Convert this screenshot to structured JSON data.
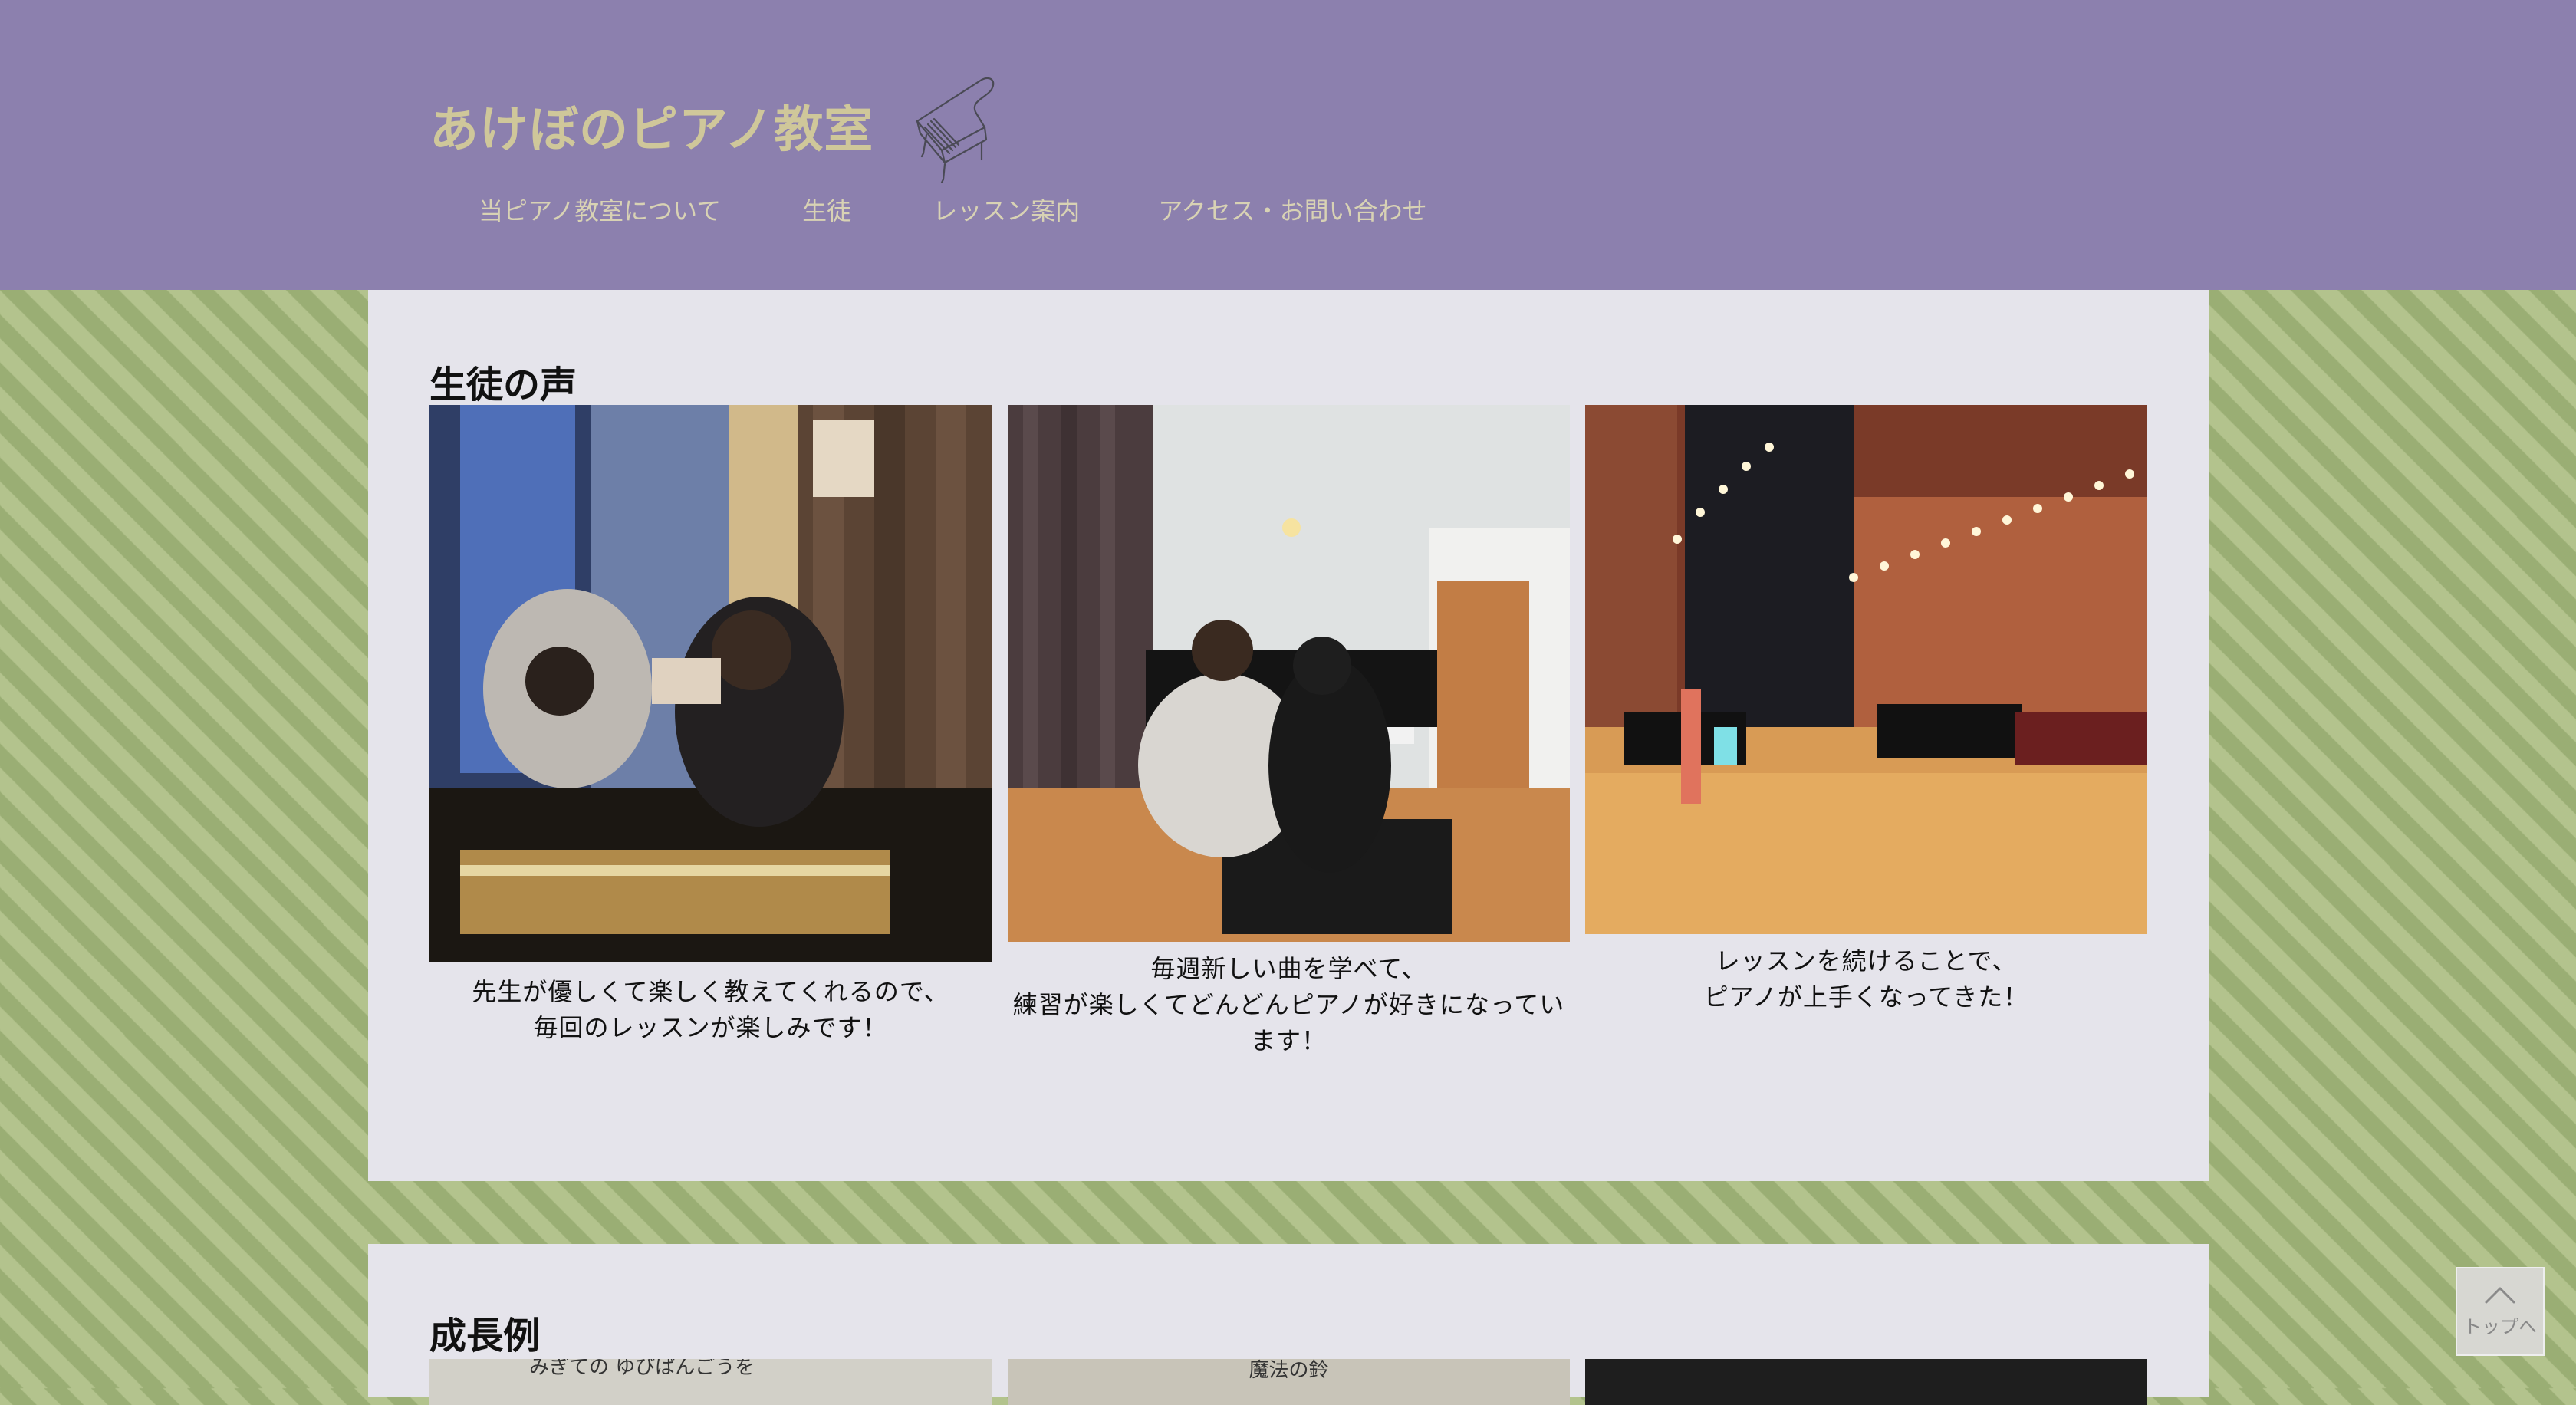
{
  "header": {
    "site_title": "あけぼのピアノ教室",
    "nav": [
      "当ピアノ教室について",
      "生徒",
      "レッスン案内",
      "アクセス・お問い合わせ"
    ]
  },
  "voices_section": {
    "title": "生徒の声",
    "items": [
      {
        "caption_lines": [
          "先生が優しくて楽しく教えてくれるので、",
          "毎回のレッスンが楽しみです！"
        ]
      },
      {
        "caption_lines": [
          "毎週新しい曲を学べて、",
          "練習が楽しくてどんどんピアノが好きになってい",
          "ます！"
        ]
      },
      {
        "caption_lines": [
          "レッスンを続けることで、",
          "ピアノが上手くなってきた！"
        ]
      }
    ]
  },
  "growth_section": {
    "title": "成長例",
    "thumb_texts": [
      "みぎての ゆびばんごうを",
      "魔法の鈴"
    ]
  },
  "back_to_top": "トップへ",
  "colors": {
    "header_bg": "#8c80ae",
    "title_color": "#cfc79a",
    "panel_bg": "#e5e4eb",
    "stripe_dark": "#9aae74",
    "stripe_light": "#b3c38d"
  }
}
